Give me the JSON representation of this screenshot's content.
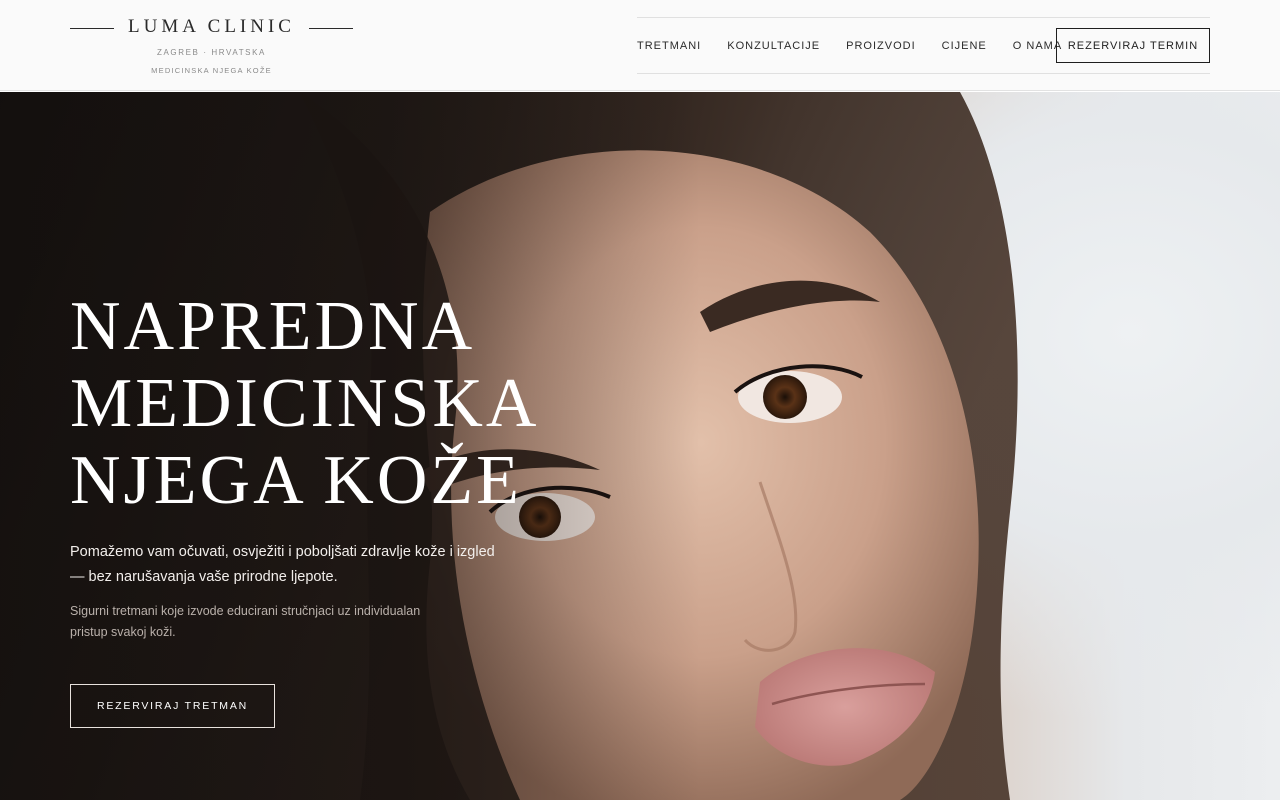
{
  "header": {
    "logo": {
      "title": "LUMA CLINIC",
      "location": "ZAGREB · HRVATSKA",
      "tagline": "MEDICINSKA NJEGA KOŽE"
    },
    "nav": [
      {
        "label": "TRETMANI"
      },
      {
        "label": "KONZULTACIJE"
      },
      {
        "label": "PROIZVODI"
      },
      {
        "label": "CIJENE"
      },
      {
        "label": "O NAMA"
      }
    ],
    "cta_label": "REZERVIRAJ TERMIN"
  },
  "hero": {
    "title_lines": [
      "NAPREDNA",
      "MEDICINSKA",
      "NJEGA KOŽE"
    ],
    "lead": "Pomažemo vam očuvati, osvježiti i poboljšati zdravlje kože i izgled — bez narušavanja vaše prirodne ljepote.",
    "note": "Sigurni tretmani koje izvode educirani stručnjaci uz individualan pristup svakoj koži.",
    "cta_label": "REZERVIRAJ TRETMAN",
    "image": "portrait-photo"
  },
  "colors": {
    "header_bg": "#fafafa",
    "text_dark": "#2a2a2a",
    "hero_text": "#ffffff",
    "hero_muted": "#b9b0aa"
  }
}
